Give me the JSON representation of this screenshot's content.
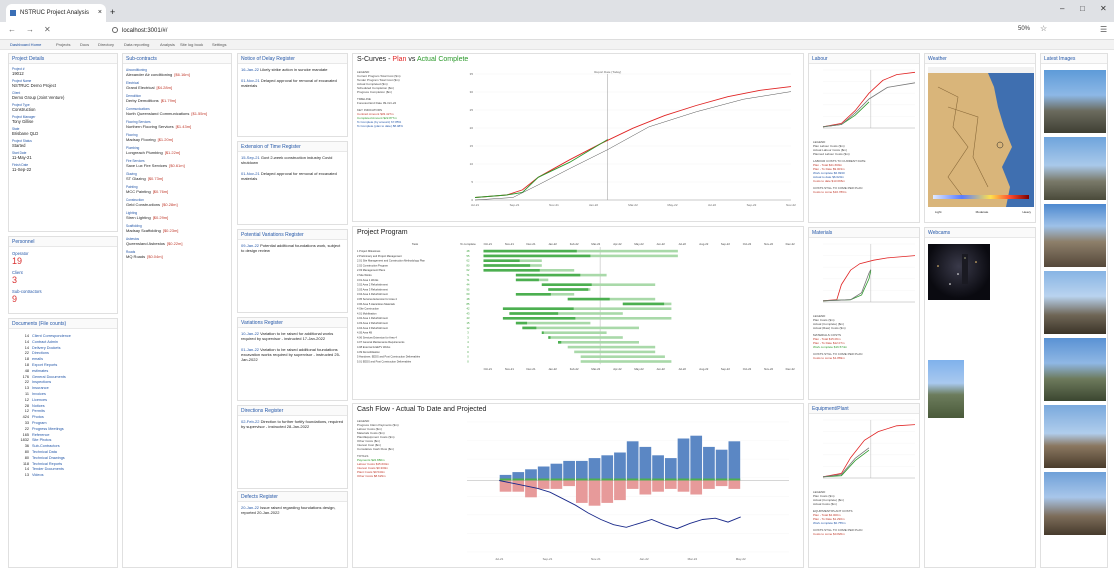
{
  "browser": {
    "tab_title": "NSTRUC Project Analysis",
    "tab_close": "×",
    "new_tab": "+",
    "url": "localhost:3001/#/",
    "zoom": "50%"
  },
  "nav": {
    "items": [
      "Dashboard Home",
      "Projects",
      "Docs",
      "Directory",
      "Data reporting",
      "Analysis",
      "Site log book",
      "Settings"
    ]
  },
  "project_details": {
    "title": "Project Details",
    "fields": [
      {
        "label": "Project #",
        "value": "19012"
      },
      {
        "label": "Project Name",
        "value": "NSTRUC Demo Project"
      },
      {
        "label": "Client",
        "value": "Demo Group (Joint Venture)"
      },
      {
        "label": "Project Type",
        "value": "Construction"
      },
      {
        "label": "Project Manager",
        "value": "Tony Gillise"
      },
      {
        "label": "State",
        "value": "Brisbane QLD"
      },
      {
        "label": "Project Status",
        "value": "Started"
      },
      {
        "label": "Start Date",
        "value": "11-May-21"
      },
      {
        "label": "Finish Date",
        "value": "11-Sep-22"
      }
    ]
  },
  "personnel": {
    "title": "Personnel",
    "items": [
      {
        "label": "Operator",
        "value": "19"
      },
      {
        "label": "Client",
        "value": "3"
      },
      {
        "label": "Sub-contractors",
        "value": "9"
      }
    ]
  },
  "documents": {
    "title": "Documents (File counts)",
    "items": [
      {
        "count": "14",
        "name": "Client Correspondence"
      },
      {
        "count": "14",
        "name": "Contract Admin"
      },
      {
        "count": "14",
        "name": "Delivery Dockets"
      },
      {
        "count": "22",
        "name": "Directions"
      },
      {
        "count": "18",
        "name": "emails"
      },
      {
        "count": "18",
        "name": "Export Reports"
      },
      {
        "count": "48",
        "name": "estimates"
      },
      {
        "count": "176",
        "name": "General Documents"
      },
      {
        "count": "22",
        "name": "Inspections"
      },
      {
        "count": "13",
        "name": "Insurance"
      },
      {
        "count": "11",
        "name": "Invoices"
      },
      {
        "count": "12",
        "name": "Licences"
      },
      {
        "count": "28",
        "name": "Notices"
      },
      {
        "count": "12",
        "name": "Permits"
      },
      {
        "count": "424",
        "name": "Photos"
      },
      {
        "count": "33",
        "name": "Program"
      },
      {
        "count": "22",
        "name": "Progress Meetings"
      },
      {
        "count": "165",
        "name": "Reference"
      },
      {
        "count": "1832",
        "name": "Site Photos"
      },
      {
        "count": "36",
        "name": "Sub-Contractors"
      },
      {
        "count": "80",
        "name": "Technical Data"
      },
      {
        "count": "80",
        "name": "Technical Drawings"
      },
      {
        "count": "118",
        "name": "Technical Reports"
      },
      {
        "count": "14",
        "name": "Tender Documents"
      },
      {
        "count": "13",
        "name": "Videos"
      }
    ]
  },
  "subcontracts": {
    "title": "Sub-contracts",
    "items": [
      {
        "category": "Airconditioning",
        "name": "Alexander Air conditioning",
        "amount": "[$6.16m]"
      },
      {
        "category": "Electrical",
        "name": "Grand Electrical",
        "amount": "[$4.28m]"
      },
      {
        "category": "Demolition",
        "name": "Derby Demolitions",
        "amount": "[$1.79m]"
      },
      {
        "category": "Communications",
        "name": "North Queensland Communications",
        "amount": "[$1.55m]"
      },
      {
        "category": "Flooring Services",
        "name": "Northern Flooring Services",
        "amount": "[$1.43m]"
      },
      {
        "category": "Flooring",
        "name": "Madsay Flooring",
        "amount": "[$1.20m]"
      },
      {
        "category": "Plumbing",
        "name": "Longreach Plumbing",
        "amount": "[$1.22m]"
      },
      {
        "category": "Fire Services",
        "name": "Saxe Lux Fire Services",
        "amount": "[$0.61m]"
      },
      {
        "category": "Glazing",
        "name": "ST Glazing",
        "amount": "[$0.73m]"
      },
      {
        "category": "Painting",
        "name": "MCC Painting",
        "amount": "[$0.76m]"
      },
      {
        "category": "Construction",
        "name": "Geld Constructions",
        "amount": "[$0.28m]"
      },
      {
        "category": "Lighting",
        "name": "Stren Lighting",
        "amount": "[$0.29m]"
      },
      {
        "category": "Scaffolding",
        "name": "Madsay Scaffolding",
        "amount": "[$0.23m]"
      },
      {
        "category": "Asbestos",
        "name": "Queensland Asbestos",
        "amount": "[$0.22m]"
      },
      {
        "category": "Roads",
        "name": "MQ Roads",
        "amount": "[$0.04m]"
      }
    ]
  },
  "registers": [
    {
      "title": "Notice of Delay Register",
      "entries": [
        {
          "date": "16-Jan-22",
          "text": "Likely strike action in suncke mandate"
        },
        {
          "date": "01-Nov-21",
          "text": "Delayed approval for removal of excavated materials"
        }
      ]
    },
    {
      "title": "Extension of Time Register",
      "entries": [
        {
          "date": "15-Sep-21",
          "text": "Govt 2-week construction industry Covid shutdown"
        },
        {
          "date": "01-Nov-21",
          "text": "Delayed approval for removal of excavated materials"
        }
      ]
    },
    {
      "title": "Potential Variations Register",
      "entries": [
        {
          "date": "09-Jan-22",
          "text": "Potential additional foundations work, subject to design review"
        }
      ]
    },
    {
      "title": "Variations Register",
      "entries": [
        {
          "date": "10-Jan-22",
          "text": "Variation to be raised for additional works required by supervisor - instructed 17-Jan-2022"
        },
        {
          "date": "01-Jan-22",
          "text": "Variation to be raised additional foundations excavation works required by supervisor - instructed 25-Jan-2022"
        }
      ]
    },
    {
      "title": "Directions Register",
      "entries": [
        {
          "date": "02-Feb-22",
          "text": "Direction to further fortify foundations, required by supervisor - instructed 28-Jan-2022"
        }
      ]
    },
    {
      "title": "Defects Register",
      "entries": [
        {
          "date": "20-Jan-22",
          "text": "Issue raised regarding foundations design, reported 20-Jan-2022"
        }
      ]
    }
  ],
  "scurves": {
    "title_prefix": "S-Curves -",
    "title_plan": "Plan",
    "title_vs": "vs",
    "title_actual": "Actual Complete",
    "legend_title": "LEGEND",
    "legend": [
      "Current Program Total Cost ($m)",
      "Tender Program Total Cost ($m)",
      "Actual Completed ($m)",
      "Scheduled Completion ($m)",
      "Progress Completion ($m)"
    ],
    "timeline_title": "TIMELINE",
    "timeline": [
      {
        "label": "Forecast End Date",
        "value": "09-Oct-22"
      }
    ],
    "metrics_title": "KEY INDICATORS",
    "metrics": [
      {
        "label": "Contract Amount",
        "value": "$33.427m",
        "color": "r"
      },
      {
        "label": "Completed Amount",
        "value": "$22.877m",
        "color": "g"
      },
      {
        "label": "% Complete (by amount)",
        "value": "67.85%",
        "color": "b"
      },
      {
        "label": "% Complete (plan to date)",
        "value": "88.48%",
        "color": "b"
      }
    ],
    "marker_label": "Report Date (Today)",
    "y_ticks": [
      "35",
      "30",
      "25",
      "20",
      "15",
      "10",
      "5",
      "0"
    ],
    "x_ticks": [
      "Jul-21",
      "Sep-21",
      "Nov-21",
      "Jan-22",
      "Mar-22",
      "May-22",
      "Jul-22",
      "Sep-22",
      "Nov-22"
    ]
  },
  "program": {
    "title": "Project Program",
    "col_task": "Task",
    "col_pct": "% complete",
    "months": [
      "Oct-21",
      "Nov-21",
      "Dec-21",
      "Jan-22",
      "Feb-22",
      "Mar-22",
      "Apr-22",
      "May-22",
      "Jun-22",
      "Jul-22",
      "Aug-22",
      "Sep-22",
      "Oct-22",
      "Nov-22",
      "Dec-22"
    ],
    "tasks": [
      {
        "name": "1 Project Milestones",
        "pct": "48",
        "s": 0.02,
        "e": 0.62
      },
      {
        "name": "2 Preliminary and Project Management",
        "pct": "55",
        "s": 0.02,
        "e": 0.62
      },
      {
        "name": "2.01 Site Management and Construction Methodology Plan",
        "pct": "62",
        "s": 0.02,
        "e": 0.2
      },
      {
        "name": "2.02 Construction Program",
        "pct": "80",
        "s": 0.02,
        "e": 0.2
      },
      {
        "name": "2.03 Management Plans",
        "pct": "62",
        "s": 0.02,
        "e": 0.3
      },
      {
        "name": "3 Site Works",
        "pct": "71",
        "s": 0.12,
        "e": 0.4
      },
      {
        "name": "3.01 Area 1 Works",
        "pct": "71",
        "s": 0.12,
        "e": 0.22
      },
      {
        "name": "3.02 Area 2 Refurbishment",
        "pct": "44",
        "s": 0.2,
        "e": 0.55
      },
      {
        "name": "3.03 Area 3 Refurbishment",
        "pct": "95",
        "s": 0.22,
        "e": 0.35
      },
      {
        "name": "3.04 Area 4 Refurbishment",
        "pct": "60",
        "s": 0.12,
        "e": 0.3
      },
      {
        "name": "3.05 Services Extension for Area 4",
        "pct": "48",
        "s": 0.28,
        "e": 0.55
      },
      {
        "name": "3.06 Area 5 Hazardous Materials",
        "pct": "85",
        "s": 0.45,
        "e": 0.6
      },
      {
        "name": "4 Site Construction",
        "pct": "42",
        "s": 0.08,
        "e": 0.6
      },
      {
        "name": "4.01 Mobilisation",
        "pct": "43",
        "s": 0.1,
        "e": 0.45
      },
      {
        "name": "4.02 Area 1 Refurbishment",
        "pct": "43",
        "s": 0.08,
        "e": 0.6
      },
      {
        "name": "4.03 Area 2 Refurbishment",
        "pct": "15",
        "s": 0.12,
        "e": 0.35
      },
      {
        "name": "4.04 Area 3 Refurbishment",
        "pct": "12",
        "s": 0.14,
        "e": 0.5
      },
      {
        "name": "4.05 Area 4B",
        "pct": "3",
        "s": 0.2,
        "e": 0.4
      },
      {
        "name": "4.06 Services Extension for Area 4",
        "pct": "3",
        "s": 0.22,
        "e": 0.45
      },
      {
        "name": "4.07 General Maintenance Requirements",
        "pct": "4",
        "s": 0.25,
        "e": 0.5
      },
      {
        "name": "4.08 External & EETV Works",
        "pct": "0",
        "s": 0.28,
        "e": 0.55
      },
      {
        "name": "4.09 Demobilisation",
        "pct": "0",
        "s": 0.3,
        "e": 0.55
      },
      {
        "name": "5 Handover, EEDS and Post Construction Deliverables",
        "pct": "0",
        "s": 0.32,
        "e": 0.58
      },
      {
        "name": "5.01 EEDS and Post Construction Deliverables",
        "pct": "0",
        "s": 0.32,
        "e": 0.6
      }
    ]
  },
  "cashflow": {
    "title": "Cash Flow - Actual To Date and Projected",
    "legend_title": "LEGEND",
    "legend": [
      "Progress Claim Payments ($m)",
      "Labour Costs ($m)",
      "Materials Costs ($m)",
      "Plant/Equipment Costs ($m)",
      "Other Costs ($m)",
      "Interest Cost ($m)",
      "Cumulative Cash Flow ($m)"
    ],
    "totals_title": "TOTALS",
    "totals": [
      {
        "label": "Payments",
        "value": "$22.880m",
        "color": "g"
      },
      {
        "label": "Labour Costs",
        "value": "$15.604m",
        "color": "r"
      },
      {
        "label": "Interest Costs",
        "value": "$0.300m",
        "color": "r"
      },
      {
        "label": "Plant Costs",
        "value": "$0.540m",
        "color": "r"
      },
      {
        "label": "Other Costs",
        "value": "$8.629m",
        "color": "r"
      }
    ],
    "months": [
      "Jul-21",
      "Sep-21",
      "Nov-21",
      "Jan-22",
      "Mar-22",
      "May-22"
    ],
    "bars_pos": [
      2,
      3,
      4,
      5,
      6,
      7,
      7,
      8,
      9,
      10,
      14,
      12,
      9,
      8,
      15,
      16,
      12,
      11,
      14
    ],
    "bars_neg": [
      4,
      4,
      6,
      3,
      3,
      2,
      8,
      9,
      8,
      7,
      3,
      5,
      4,
      3,
      4,
      5,
      3,
      2,
      3
    ],
    "cumulative": [
      0,
      -2,
      -4,
      -6,
      -9,
      -14,
      -19,
      -25,
      -30,
      -34,
      -36,
      -33,
      -30,
      -34,
      -37,
      -33,
      -30,
      -29,
      -32,
      -28
    ]
  },
  "labour": {
    "title": "Labour",
    "legend_title": "LEGEND",
    "legend": [
      "Plan Labour Costs ($m)",
      "Actual Labour Costs ($m)",
      "Planned Labour Costs ($m)"
    ],
    "summary_title": "LABOUR COSTS TO CURRENT DATE",
    "summary": [
      {
        "label": "Plan - Total",
        "value": "$21.669m",
        "color": "r"
      },
      {
        "label": "Plan - To Date",
        "value": "$9.003m",
        "color": "r"
      },
      {
        "label": "Work complete",
        "value": "$6.9930",
        "color": "b"
      },
      {
        "label": "Actual to date",
        "value": "$6.620m",
        "color": "b"
      },
      {
        "label": "Costs to date",
        "value": "$13.096m",
        "color": "r"
      }
    ],
    "costs_title": "COSTS STILL TO COME PER PLAN",
    "costs_label": "Costs to come",
    "costs_value": "$16.786m"
  },
  "materials": {
    "title": "Materials",
    "legend_title": "LEGEND",
    "legend": [
      "Plan Costs ($m)",
      "Actual (Complete) ($m)",
      "Actual (Raw) Costs ($m)"
    ],
    "summary_title": "MATERIALS COSTS",
    "summary": [
      {
        "label": "Plan - Total",
        "value": "$15.06m",
        "color": "r"
      },
      {
        "label": "Plan - To Date",
        "value": "$12.07m",
        "color": "r"
      },
      {
        "label": "Work complete",
        "value": "$16.574m",
        "color": "g"
      }
    ],
    "costs_title": "COSTS STILL TO COME PER PLAN",
    "costs_label": "Costs to come",
    "costs_value": "$1.869m"
  },
  "equipment": {
    "title": "Equipment/Plant",
    "legend_title": "LEGEND",
    "legend": [
      "Plan Costs ($m)",
      "Actual (Complete) ($m)",
      "Actual Costs ($m)"
    ],
    "summary_title": "EQUIPMENT/PLANT COSTS",
    "summary": [
      {
        "label": "Plan - Total",
        "value": "$2.000m",
        "color": "r"
      },
      {
        "label": "Plan - To Date",
        "value": "$1.290m",
        "color": "r"
      },
      {
        "label": "Work complete",
        "value": "$0.755m",
        "color": "b"
      }
    ],
    "costs_title": "COSTS STILL TO COME PER PLAN",
    "costs_label": "Costs to come",
    "costs_value": "$0.820m"
  },
  "weather": {
    "title": "Weather",
    "scale": [
      "Light",
      "Moderate",
      "Heavy"
    ]
  },
  "webcams": {
    "title": "Webcams"
  },
  "latest_images": {
    "title": "Latest Images"
  },
  "colors": {
    "plan": "#e02424",
    "actual": "#2c9a2c",
    "accent": "#2457a8",
    "bar_blue": "#5b87c4"
  }
}
